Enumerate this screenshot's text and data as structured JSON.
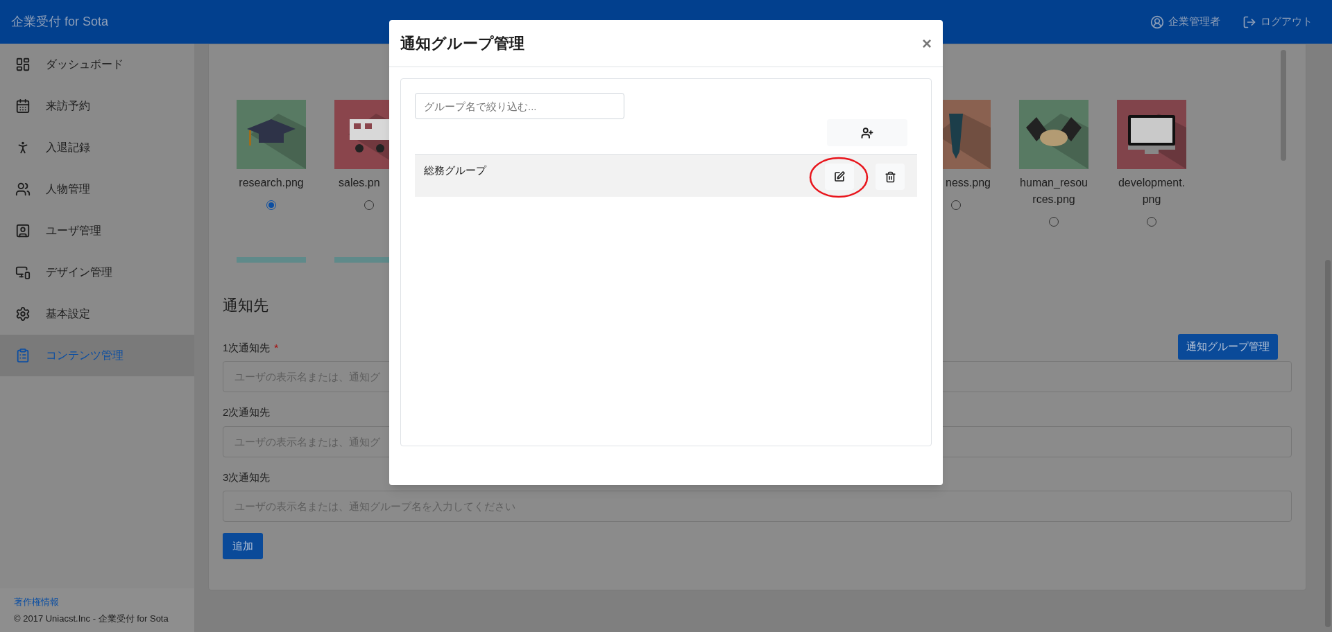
{
  "header": {
    "title": "企業受付 for Sota",
    "user": "企業管理者",
    "logout": "ログアウト"
  },
  "sidebar": {
    "items": [
      {
        "label": "ダッシュボード",
        "selected": false
      },
      {
        "label": "来訪予約",
        "selected": false
      },
      {
        "label": "入退記録",
        "selected": false
      },
      {
        "label": "人物管理",
        "selected": false
      },
      {
        "label": "ユーザ管理",
        "selected": false
      },
      {
        "label": "デザイン管理",
        "selected": false
      },
      {
        "label": "基本設定",
        "selected": false
      },
      {
        "label": "コンテンツ管理",
        "selected": true
      }
    ],
    "footer_link": "著作権情報",
    "copyright": "© 2017 Uniacst.Inc - 企業受付 for Sota"
  },
  "images": [
    {
      "label": "research.png",
      "selected": true
    },
    {
      "label": "sales.pn",
      "selected": false
    },
    {
      "label": "ness.png",
      "selected": false
    },
    {
      "label": "human_resources.png",
      "selected": false
    },
    {
      "label": "development.png",
      "selected": false
    }
  ],
  "notify": {
    "heading": "通知先",
    "group_button": "通知グループ管理",
    "fields": [
      {
        "label": "1次通知先",
        "required_mark": "*",
        "placeholder": "ユーザの表示名または、通知グ"
      },
      {
        "label": "2次通知先",
        "placeholder": "ユーザの表示名または、通知グ"
      },
      {
        "label": "3次通知先",
        "placeholder": "ユーザの表示名または、通知グループ名を入力してください"
      }
    ],
    "add_button": "追加"
  },
  "modal": {
    "title": "通知グループ管理",
    "close": "×",
    "filter_placeholder": "グループ名で絞り込む...",
    "groups": [
      {
        "name": "総務グループ",
        "edit_circled": true
      }
    ]
  }
}
